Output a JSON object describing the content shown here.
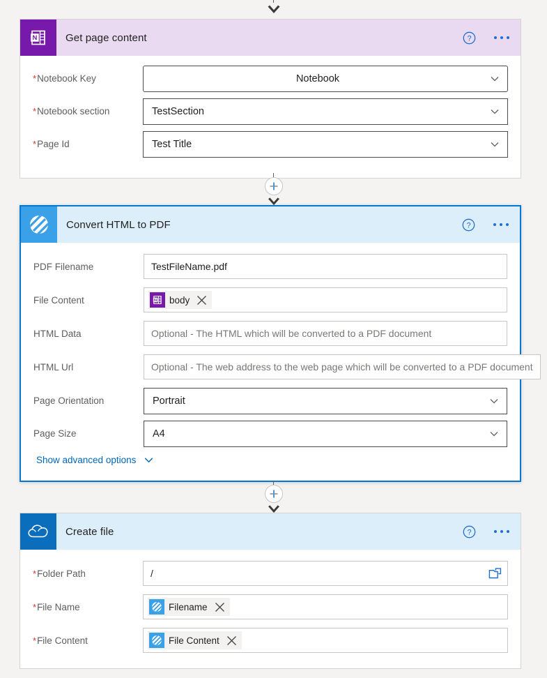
{
  "colors": {
    "page_background": "#f4f3f2",
    "onenote_purple": "#7719aa",
    "onenote_header": "#e9daf2",
    "convertapi_blue": "#3aa0e8",
    "light_blue_header": "#ddeefb",
    "onedrive_blue": "#0a6ebd",
    "selection_border": "#0078d4",
    "link_blue": "#0067b8",
    "required_red": "#d13438",
    "label_gray": "#605e5c",
    "placeholder_gray": "#7a7775"
  },
  "cards": [
    {
      "id": "get-page-content",
      "title": "Get page content",
      "icon": "onenote-icon",
      "selected": false,
      "help_label": "?",
      "menu_label": "...",
      "fields": [
        {
          "name": "notebook-key",
          "label": "Notebook Key",
          "required": true,
          "control": "dropdown",
          "value": "Notebook",
          "align": "center",
          "rounded": true
        },
        {
          "name": "notebook-section",
          "label": "Notebook section",
          "required": true,
          "control": "dropdown",
          "value": "TestSection",
          "align": "left",
          "rounded": false
        },
        {
          "name": "page-id",
          "label": "Page Id",
          "required": true,
          "control": "dropdown",
          "value": "Test Title",
          "align": "left",
          "rounded": false
        }
      ]
    },
    {
      "id": "convert-html-to-pdf",
      "title": "Convert HTML to PDF",
      "icon": "convertapi-icon",
      "selected": true,
      "help_label": "?",
      "menu_label": "...",
      "advanced_options_label": "Show advanced options",
      "fields": [
        {
          "name": "pdf-filename",
          "label": "PDF Filename",
          "required": false,
          "control": "textbox",
          "value": "TestFileName.pdf",
          "placeholder": ""
        },
        {
          "name": "file-content",
          "label": "File Content",
          "required": false,
          "control": "token",
          "token_label": "body",
          "token_icon": "onenote-icon"
        },
        {
          "name": "html-data",
          "label": "HTML Data",
          "required": false,
          "control": "textbox",
          "value": "",
          "placeholder": "Optional - The HTML which will be converted to a PDF document"
        },
        {
          "name": "html-url",
          "label": "HTML Url",
          "required": false,
          "control": "textbox",
          "value": "",
          "placeholder": "Optional - The web address to the web page which will be converted to a PDF document"
        },
        {
          "name": "page-orientation",
          "label": "Page Orientation",
          "required": false,
          "control": "dropdown",
          "value": "Portrait",
          "align": "left",
          "rounded": false
        },
        {
          "name": "page-size",
          "label": "Page Size",
          "required": false,
          "control": "dropdown",
          "value": "A4",
          "align": "left",
          "rounded": false
        }
      ]
    },
    {
      "id": "create-file",
      "title": "Create file",
      "icon": "onedrive-icon",
      "selected": false,
      "help_label": "?",
      "menu_label": "...",
      "fields": [
        {
          "name": "folder-path",
          "label": "Folder Path",
          "required": true,
          "control": "textbox",
          "value": "/",
          "placeholder": "",
          "picker": "folder-picker-icon"
        },
        {
          "name": "file-name",
          "label": "File Name",
          "required": true,
          "control": "token",
          "token_label": "Filename",
          "token_icon": "convertapi-icon"
        },
        {
          "name": "file-content",
          "label": "File Content",
          "required": true,
          "control": "token",
          "token_label": "File Content",
          "token_icon": "convertapi-icon"
        }
      ]
    }
  ],
  "connectors": [
    {
      "name": "connector-top",
      "has_plus": false
    },
    {
      "name": "connector-1",
      "has_plus": true,
      "plus_label": "+"
    },
    {
      "name": "connector-2",
      "has_plus": true,
      "plus_label": "+"
    }
  ]
}
